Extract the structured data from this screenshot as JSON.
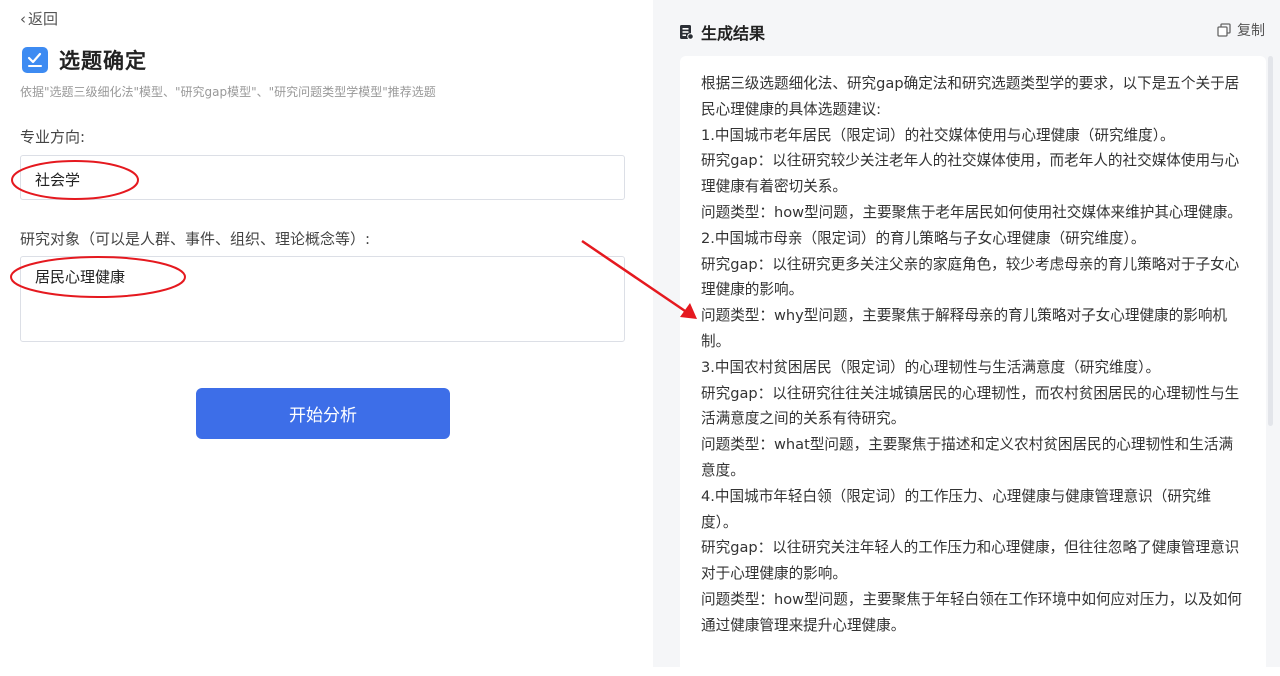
{
  "back": {
    "label": "返回"
  },
  "page": {
    "title": "选题确定",
    "subtitle": "依据\"选题三级细化法\"模型、\"研究gap模型\"、\"研究问题类型学模型\"推荐选题"
  },
  "form": {
    "major_label": "专业方向:",
    "major_value": "社会学",
    "object_label": "研究对象（可以是人群、事件、组织、理论概念等）:",
    "object_value": "居民心理健康"
  },
  "actions": {
    "start_label": "开始分析"
  },
  "result": {
    "header_title": "生成结果",
    "copy_label": "复制",
    "lines": [
      "根据三级选题细化法、研究gap确定法和研究选题类型学的要求，以下是五个关于居民心理健康的具体选题建议:",
      "1.中国城市老年居民（限定词）的社交媒体使用与心理健康（研究维度）。",
      "研究gap：以往研究较少关注老年人的社交媒体使用，而老年人的社交媒体使用与心理健康有着密切关系。",
      "问题类型：how型问题，主要聚焦于老年居民如何使用社交媒体来维护其心理健康。",
      "2.中国城市母亲（限定词）的育儿策略与子女心理健康（研究维度）。",
      "研究gap：以往研究更多关注父亲的家庭角色，较少考虑母亲的育儿策略对于子女心理健康的影响。",
      "问题类型：why型问题，主要聚焦于解释母亲的育儿策略对子女心理健康的影响机制。",
      "3.中国农村贫困居民（限定词）的心理韧性与生活满意度（研究维度）。",
      "研究gap：以往研究往往关注城镇居民的心理韧性，而农村贫困居民的心理韧性与生活满意度之间的关系有待研究。",
      "问题类型：what型问题，主要聚焦于描述和定义农村贫困居民的心理韧性和生活满意度。",
      "4.中国城市年轻白领（限定词）的工作压力、心理健康与健康管理意识（研究维度）。",
      "研究gap：以往研究关注年轻人的工作压力和心理健康，但往往忽略了健康管理意识对于心理健康的影响。",
      "问题类型：how型问题，主要聚焦于年轻白领在工作环境中如何应对压力，以及如何通过健康管理来提升心理健康。"
    ]
  },
  "colors": {
    "primary": "#3d6ee8",
    "annotation": "#e5191f",
    "panel_bg": "#f5f6f8"
  },
  "icons": {
    "back": "chevron-left-icon",
    "title": "checklist-icon",
    "result": "document-icon",
    "copy": "copy-icon"
  }
}
